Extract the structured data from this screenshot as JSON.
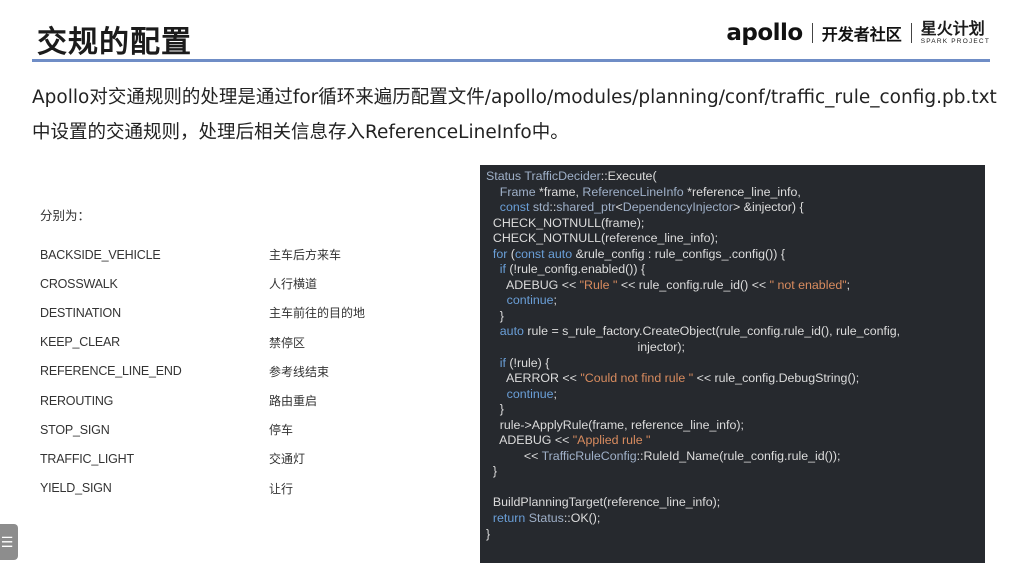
{
  "slide": {
    "title": "交规的配置",
    "brand": {
      "apollo": "apollo",
      "community": "开发者社区",
      "spark_cn": "星火计划",
      "spark_en": "SPARK PROJECT"
    },
    "intro_line1": "Apollo对交通规则的处理是通过for循环来遍历配置文件/apollo/modules/planning/conf/traffic_rule_config.pb.txt",
    "intro_line2": "中设置的交通规则，处理后相关信息存入ReferenceLineInfo中。",
    "rules_title": "分别为：",
    "rules": [
      {
        "name": "BACKSIDE_VEHICLE",
        "desc": "主车后方来车"
      },
      {
        "name": "CROSSWALK",
        "desc": "人行横道"
      },
      {
        "name": "DESTINATION",
        "desc": "主车前往的目的地"
      },
      {
        "name": "KEEP_CLEAR",
        "desc": "禁停区"
      },
      {
        "name": "REFERENCE_LINE_END",
        "desc": "参考线结束"
      },
      {
        "name": "REROUTING",
        "desc": "路由重启"
      },
      {
        "name": "STOP_SIGN",
        "desc": "停车"
      },
      {
        "name": "TRAFFIC_LIGHT",
        "desc": "交通灯"
      },
      {
        "name": "YIELD_SIGN",
        "desc": "让行"
      }
    ],
    "side_tab_icon": "menu-icon"
  },
  "code": {
    "lines": [
      "Status TrafficDecider::Execute(",
      "    Frame *frame, ReferenceLineInfo *reference_line_info,",
      "    const std::shared_ptr<DependencyInjector> &injector) {",
      "  CHECK_NOTNULL(frame);",
      "  CHECK_NOTNULL(reference_line_info);",
      "  for (const auto &rule_config : rule_configs_.config()) {",
      "    if (!rule_config.enabled()) {",
      "      ADEBUG << \"Rule \" << rule_config.rule_id() << \" not enabled\";",
      "      continue;",
      "    }",
      "    auto rule = s_rule_factory.CreateObject(rule_config.rule_id(), rule_config,",
      "                                            injector);",
      "    if (!rule) {",
      "      AERROR << \"Could not find rule \" << rule_config.DebugString();",
      "      continue;",
      "    }",
      "    rule->ApplyRule(frame, reference_line_info);",
      "    ADEBUG << \"Applied rule \"",
      "           << TrafficRuleConfig::RuleId_Name(rule_config.rule_id());",
      "  }",
      "",
      "  BuildPlanningTarget(reference_line_info);",
      "  return Status::OK();",
      "}"
    ]
  }
}
